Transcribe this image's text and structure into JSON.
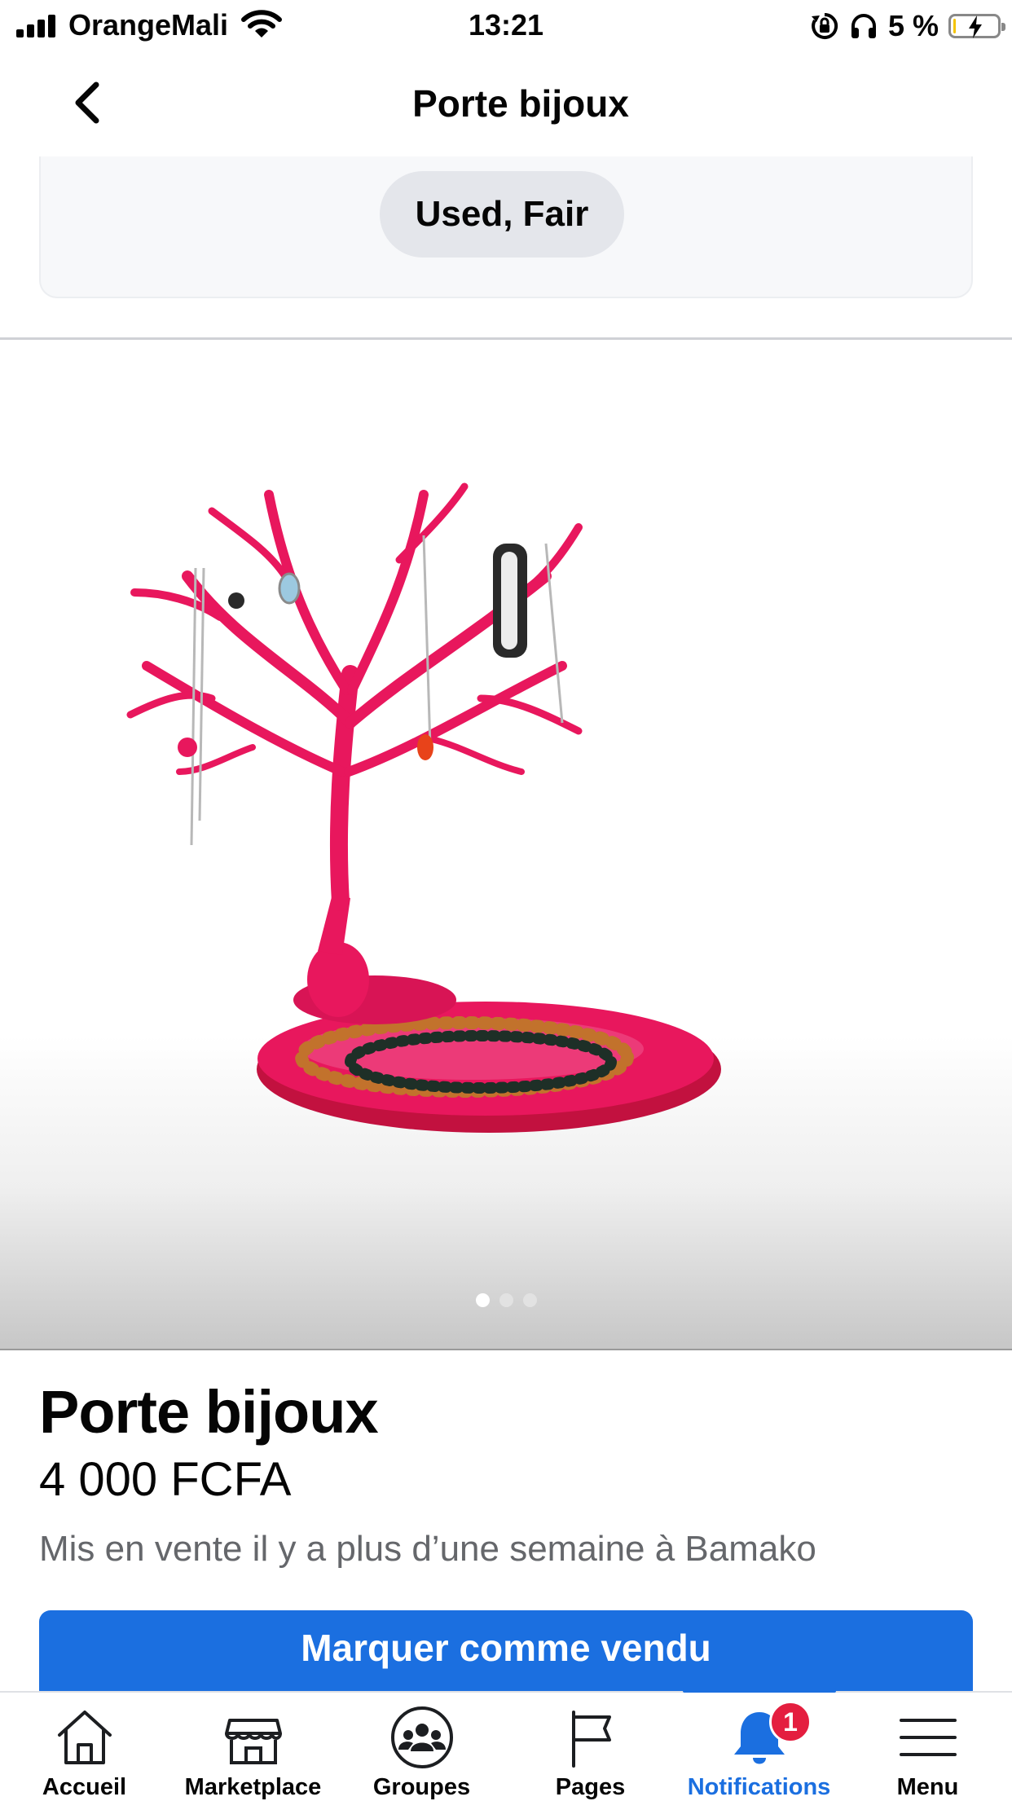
{
  "status_bar": {
    "carrier": "OrangeMali",
    "time": "13:21",
    "battery_percent": "5 %",
    "battery_level": 0.05,
    "icons": [
      "signal-icon",
      "wifi-icon",
      "orientation-lock-icon",
      "headphones-icon",
      "battery-charging-icon"
    ]
  },
  "nav": {
    "title": "Porte bijoux",
    "back_icon": "chevron-left-icon"
  },
  "listing": {
    "condition": "Used, Fair",
    "title": "Porte bijoux",
    "price": "4 000 FCFA",
    "meta": "Mis en vente il y a plus d’une semaine à Bamako",
    "photo_count": 3,
    "active_photo": 1,
    "primary_action": "Marquer comme vendu"
  },
  "tab_bar": {
    "items": [
      {
        "label": "Accueil",
        "icon": "home-icon"
      },
      {
        "label": "Marketplace",
        "icon": "marketplace-icon"
      },
      {
        "label": "Groupes",
        "icon": "groups-icon"
      },
      {
        "label": "Pages",
        "icon": "flag-icon"
      },
      {
        "label": "Notifications",
        "icon": "bell-icon",
        "badge": "1",
        "active": true
      },
      {
        "label": "Menu",
        "icon": "menu-icon"
      }
    ]
  },
  "colors": {
    "accent": "#1b6fe0",
    "badge": "#e41e3f",
    "product_pink": "#e8175d"
  }
}
